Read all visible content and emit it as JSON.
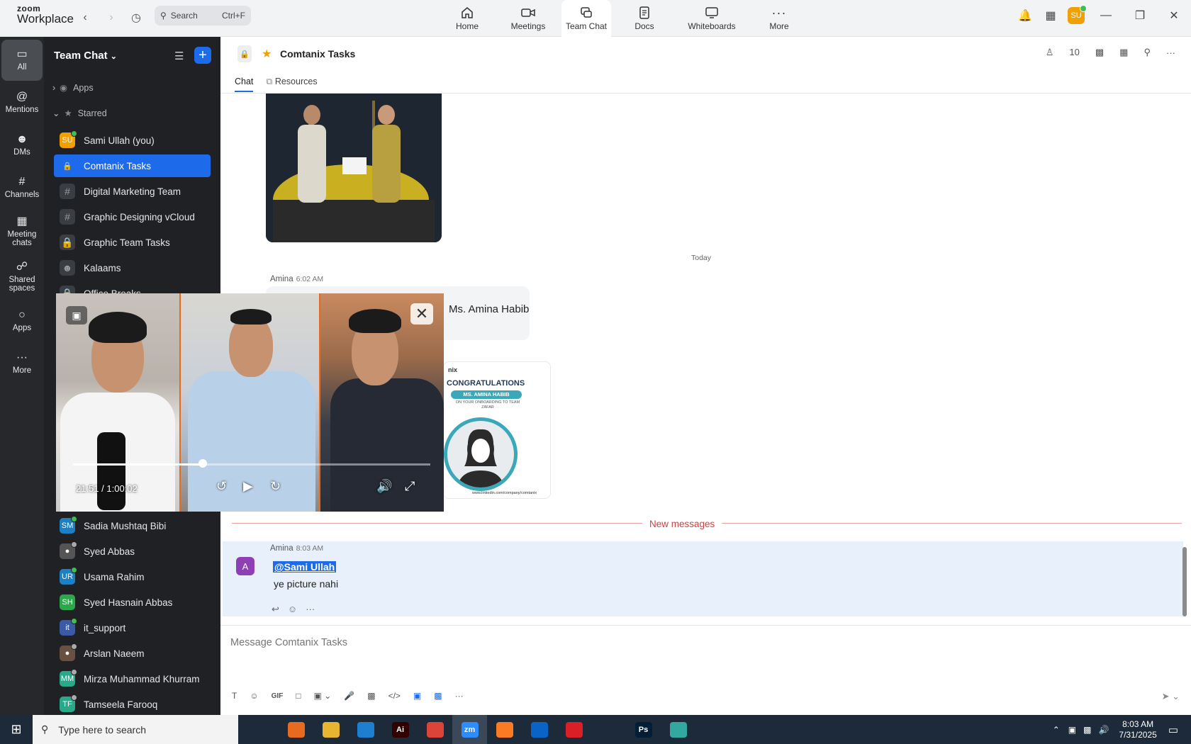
{
  "app": {
    "logo_line1": "zoom",
    "logo_line2": "Workplace"
  },
  "titlebar": {
    "search_placeholder": "Search",
    "search_shortcut": "Ctrl+F",
    "tabs": [
      {
        "label": "Home",
        "icon": "home-icon"
      },
      {
        "label": "Meetings",
        "icon": "video-camera-icon"
      },
      {
        "label": "Team Chat",
        "icon": "chat-icon",
        "active": true
      },
      {
        "label": "Docs",
        "icon": "document-icon"
      },
      {
        "label": "Whiteboards",
        "icon": "whiteboard-icon"
      },
      {
        "label": "More",
        "icon": "more-icon"
      }
    ],
    "user_initials": "SU"
  },
  "rail": [
    {
      "label": "All",
      "icon": "chat-bubble-icon",
      "active": true
    },
    {
      "label": "Mentions",
      "icon": "at-icon"
    },
    {
      "label": "DMs",
      "icon": "people-icon"
    },
    {
      "label": "Channels",
      "icon": "hash-icon"
    },
    {
      "label": "Meeting chats",
      "icon": "calendar-icon"
    },
    {
      "label": "Shared spaces",
      "icon": "share-icon"
    },
    {
      "label": "Apps",
      "icon": "apps-icon"
    },
    {
      "label": "More",
      "icon": "more-icon"
    }
  ],
  "sidebar": {
    "title": "Team Chat",
    "sections": {
      "apps": "Apps",
      "starred": "Starred"
    },
    "items_top": [
      {
        "label": "Sami Ullah (you)",
        "initials": "SU",
        "color": "#f0a000",
        "type": "avatar-dot"
      },
      {
        "label": "Comtanix Tasks",
        "type": "lock",
        "active": true
      },
      {
        "label": "Digital Marketing Team",
        "type": "hash"
      },
      {
        "label": "Graphic Designing vCloud",
        "type": "hash"
      },
      {
        "label": "Graphic Team Tasks",
        "type": "lock"
      },
      {
        "label": "Kalaams",
        "type": "group"
      },
      {
        "label": "Office Breaks",
        "type": "lock"
      }
    ],
    "items_bottom": [
      {
        "label": "Sadia Mushtaq Bibi",
        "initials": "SM",
        "color": "#1d7fc4",
        "type": "avatar-dot"
      },
      {
        "label": "Syed Abbas",
        "initials": "",
        "color": "#555555",
        "type": "avatar-photo"
      },
      {
        "label": "Usama Rahim",
        "initials": "UR",
        "color": "#1d7fc4",
        "type": "avatar-dot"
      },
      {
        "label": "Syed Hasnain Abbas",
        "initials": "SH",
        "color": "#2aa84a",
        "type": "avatar-plain"
      },
      {
        "label": "it_support",
        "initials": "",
        "color": "#3a5aa8",
        "type": "avatar-dot"
      },
      {
        "label": "Arslan Naeem",
        "initials": "",
        "color": "#6a5040",
        "type": "avatar-photo"
      },
      {
        "label": "Mirza Muhammad Khurram",
        "initials": "MM",
        "color": "#2aa88a",
        "type": "avatar-gray"
      },
      {
        "label": "Tamseela Farooq",
        "initials": "TF",
        "color": "#2aa88a",
        "type": "avatar-gray"
      }
    ]
  },
  "channel": {
    "title": "Comtanix Tasks",
    "tabs": [
      "Chat",
      "Resources"
    ],
    "member_count": "10",
    "day_separator": "Today",
    "new_messages_label": "New messages",
    "composer_placeholder": "Message Comtanix Tasks"
  },
  "messages": [
    {
      "sender": "Amina",
      "time": "6:02 AM",
      "text": "Ms. Amina Habib"
    },
    {
      "sender": "Amina",
      "time": "8:03 AM",
      "avatar": "A",
      "mention": "@Sami Ullah",
      "text": "ye picture nahi"
    }
  ],
  "certificate": {
    "brand": "nix",
    "heading": "CONGRATULATIONS",
    "name": "MS. AMINA HABIB",
    "line": "ON YOUR ONBOARDING TO TEAM ZAFAR",
    "footer": "www.linkedin.com/company/comtanix"
  },
  "video": {
    "time": "21:51 / 1:00:02",
    "progress": 0.364
  },
  "taskbar": {
    "search_placeholder": "Type here to search",
    "time": "8:03 AM",
    "date": "7/31/2025",
    "apps": [
      {
        "label": "",
        "icon": "task-view-icon",
        "color": "#1c2a3a"
      },
      {
        "label": "",
        "icon": "firefox-icon",
        "color": "#e66a1f"
      },
      {
        "label": "",
        "icon": "file-explorer-icon",
        "color": "#e8b530"
      },
      {
        "label": "",
        "icon": "vscode-icon",
        "color": "#1e7fd0"
      },
      {
        "label": "Ai",
        "icon": "illustrator-icon",
        "color": "#330000"
      },
      {
        "label": "",
        "icon": "chrome-icon",
        "color": "#dc4437"
      },
      {
        "label": "zm",
        "icon": "zoom-icon",
        "color": "#2d8cff",
        "active": true
      },
      {
        "label": "",
        "icon": "xampp-icon",
        "color": "#fb7a24"
      },
      {
        "label": "",
        "icon": "outlook-icon",
        "color": "#0a64c8"
      },
      {
        "label": "",
        "icon": "creative-cloud-icon",
        "color": "#da1f26"
      },
      {
        "label": "",
        "icon": "pen-tool-icon",
        "color": "#1c2a3a"
      },
      {
        "label": "Ps",
        "icon": "photoshop-icon",
        "color": "#001e36"
      },
      {
        "label": "",
        "icon": "app-gem-icon",
        "color": "#33a8a0"
      }
    ]
  }
}
